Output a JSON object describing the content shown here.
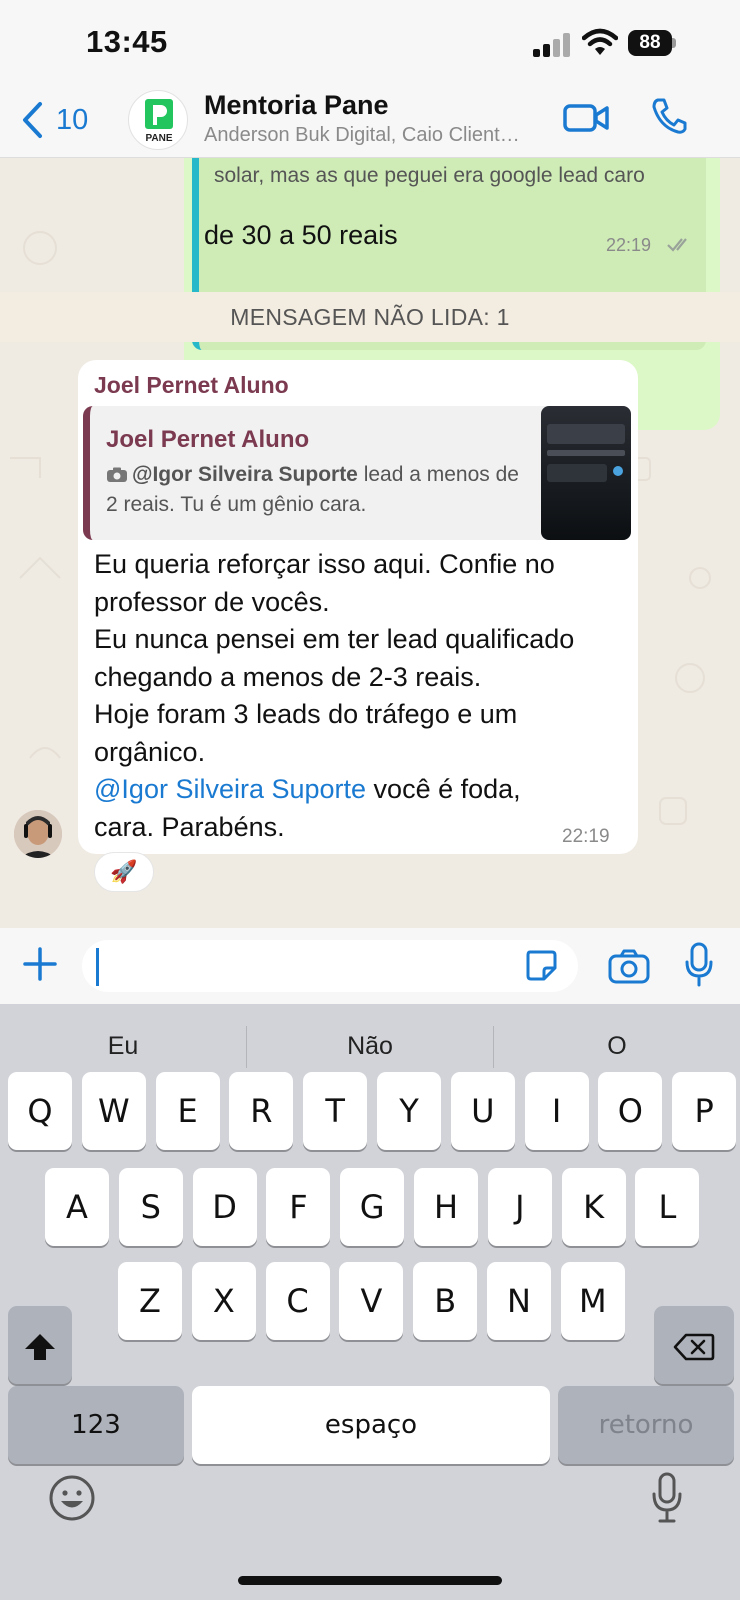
{
  "status_bar": {
    "time": "13:45",
    "battery": "88"
  },
  "header": {
    "back_count": "10",
    "title": "Mentoria Pane",
    "subtitle": "Anderson Buk Digital, Caio Client…",
    "avatar_text": "PANE"
  },
  "outgoing_message": {
    "quoted_text": "solar, mas as que peguei era google lead caro",
    "text": "de 30 a 50 reais",
    "time": "22:19"
  },
  "unread_banner": "MENSAGEM NÃO LIDA: 1",
  "incoming_message": {
    "sender": "Joel Pernet Aluno",
    "reply": {
      "name": "Joel Pernet Aluno",
      "mention": "@Igor Silveira Suporte",
      "text_after_mention": " lead a menos de 2 reais. Tu é um gênio cara."
    },
    "lines": [
      "Eu queria reforçar isso aqui. Confie no",
      "professor de vocês.",
      "Eu nunca pensei em ter lead qualificado",
      "chegando a menos de 2-3 reais.",
      "Hoje foram 3 leads do tráfego e um",
      "orgânico."
    ],
    "mention_line": {
      "at": "@",
      "name": "Igor Silveira Suporte",
      "after": " você é foda,"
    },
    "last_line": "cara. Parabéns.",
    "time": "22:19",
    "reaction": "🚀"
  },
  "keyboard": {
    "suggestions": [
      "Eu",
      "Não",
      "O"
    ],
    "row1": [
      "Q",
      "W",
      "E",
      "R",
      "T",
      "Y",
      "U",
      "I",
      "O",
      "P"
    ],
    "row2": [
      "A",
      "S",
      "D",
      "F",
      "G",
      "H",
      "J",
      "K",
      "L"
    ],
    "row3": [
      "Z",
      "X",
      "C",
      "V",
      "B",
      "N",
      "M"
    ],
    "numbers_label": "123",
    "space_label": "espaço",
    "return_label": "retorno"
  }
}
